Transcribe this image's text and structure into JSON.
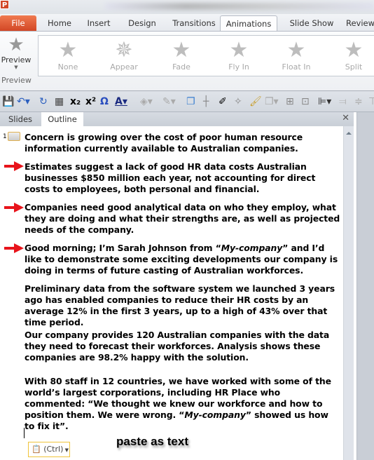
{
  "app": {
    "logo": "P"
  },
  "ribbon_tabs": [
    "File",
    "Home",
    "Insert",
    "Design",
    "Transitions",
    "Animations",
    "Slide Show",
    "Review"
  ],
  "active_tab": "Animations",
  "preview": {
    "label": "Preview",
    "group": "Preview"
  },
  "effects": [
    "None",
    "Appear",
    "Fade",
    "Fly In",
    "Float In",
    "Split"
  ],
  "pane_tabs": [
    "Slides",
    "Outline"
  ],
  "outline": {
    "slide_number": "1",
    "paragraphs": [
      "Concern is growing over the cost of poor human resource information currently available to Australian companies.",
      "Estimates suggest a lack of good HR data costs Australian businesses $850 million each year, not accounting for direct costs to employees, both personal and financial.",
      "Companies need good analytical data on who they employ, what they are doing and what their strengths are, as well as projected needs of the company.",
      "Good morning; I’m Sarah Johnson from “My-company” and I’d like to demonstrate some exciting developments our company is doing in terms of future casting of Australian workforces.",
      "Preliminary data from the software system we launched 3 years ago has enabled companies to reduce their HR costs by an average 12% in the first 3 years, up to a high of 43% over that time period.",
      "Our company provides 120 Australian companies with the data they need to forecast their workforces. Analysis shows these companies are 98.2% happy with the solution.",
      "With 80 staff in 12 countries, we have worked with some of the world’s largest corporations, including HR Place who commented: “We thought we knew our workforce and how to position them. We were wrong. “My-company” showed us how to fix it”."
    ]
  },
  "paste_options": {
    "label": "(Ctrl)"
  },
  "annotation": "paste as text",
  "colors": {
    "file_tab": "#d24726",
    "arrow": "#e8141b",
    "paste_border": "#f0c43a"
  }
}
